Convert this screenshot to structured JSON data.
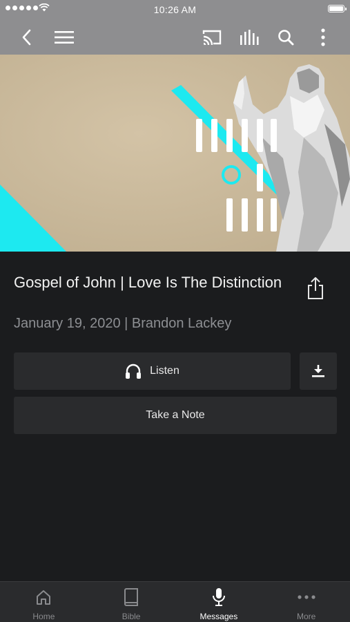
{
  "status_bar": {
    "time": "10:26 AM"
  },
  "nav": {
    "icons": [
      "back-icon",
      "menu-icon",
      "cast-icon",
      "audio-bars-icon",
      "search-icon",
      "more-vertical-icon"
    ]
  },
  "hero": {
    "art_lines": [
      "GOSPEL",
      "OF",
      "JOHN"
    ],
    "colors": {
      "paper": "#c8b89b",
      "accent": "#1de9f0"
    }
  },
  "message": {
    "title": "Gospel of John | Love Is The Distinction",
    "subtitle": "January 19, 2020 | Brandon Lackey"
  },
  "actions": {
    "listen_label": "Listen",
    "note_label": "Take a Note"
  },
  "tabs": [
    {
      "label": "Home",
      "icon": "home-icon",
      "active": false
    },
    {
      "label": "Bible",
      "icon": "book-icon",
      "active": false
    },
    {
      "label": "Messages",
      "icon": "microphone-icon",
      "active": true
    },
    {
      "label": "More",
      "icon": "more-horizontal-icon",
      "active": false
    }
  ],
  "colors": {
    "background": "#1b1c1e",
    "bar": "#8e8e90",
    "button": "#2a2b2d"
  }
}
